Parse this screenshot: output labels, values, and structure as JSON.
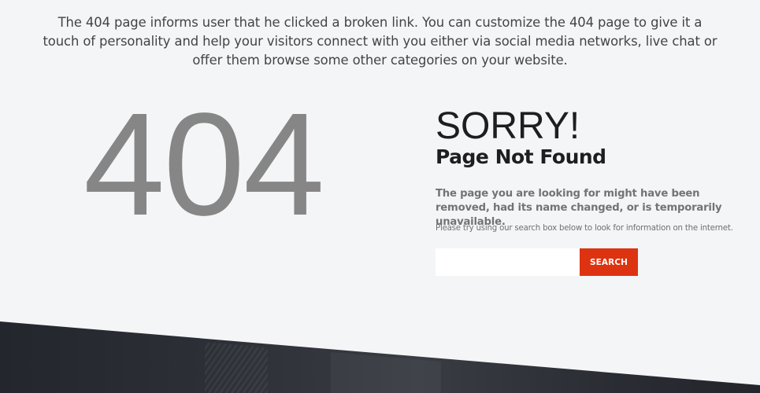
{
  "intro_text": "The 404 page informs user that he clicked a broken link. You can customize the 404 page to give it a touch of personality and help your visitors connect with you either via social media networks, live chat or offer them browse some other categories on your website.",
  "error_code": "404",
  "heading": "SORRY!",
  "subheading": "Page Not Found",
  "description": "The page you are looking for might have been removed, had its name changed, or is temporarily unavailable.",
  "hint": "Please try using our search box below to look for information on the internet.",
  "search": {
    "value": "",
    "placeholder": "",
    "button_label": "SEARCH"
  },
  "colors": {
    "background": "#f4f5f7",
    "accent": "#dd3311",
    "footer_dark": "#262830"
  }
}
